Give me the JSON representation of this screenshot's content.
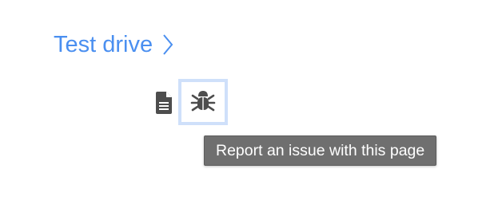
{
  "breadcrumb": {
    "label": "Test drive",
    "icon": "chevron-right-icon",
    "color": "#4a8ff0"
  },
  "toolbar": {
    "items": [
      {
        "icon": "document-icon"
      },
      {
        "icon": "bug-icon",
        "focused": true
      }
    ]
  },
  "tooltip": {
    "text": "Report an issue with this page"
  },
  "colors": {
    "icon": "#4d4d4d",
    "focus_ring": "#cfe0fa",
    "tooltip_bg": "#6f6f6f",
    "tooltip_text": "#ffffff"
  }
}
